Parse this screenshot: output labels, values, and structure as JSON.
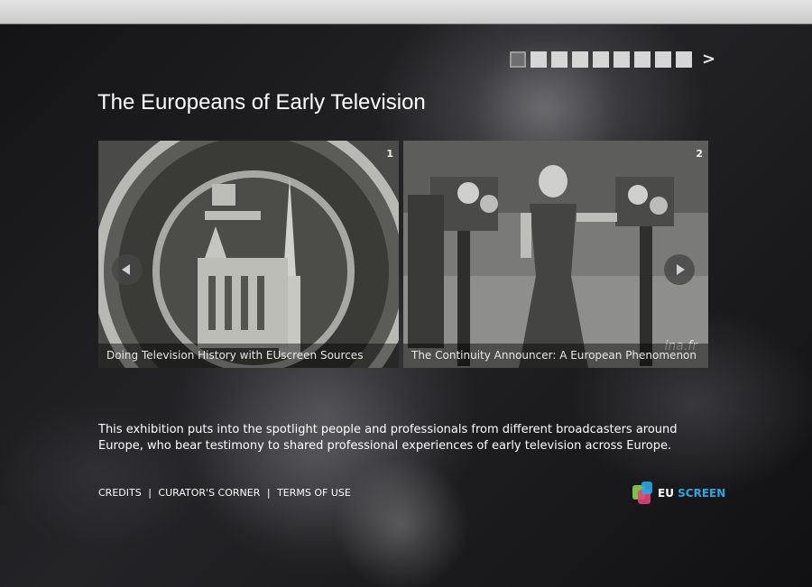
{
  "header": {
    "title": "The Europeans of Early Television"
  },
  "pager": {
    "pages": 9,
    "active": 1,
    "next_label": ">"
  },
  "tiles": [
    {
      "number": "1",
      "caption": "Doing Television History with EUscreen Sources"
    },
    {
      "number": "2",
      "caption": "The Continuity Announcer: A European Phenomenon",
      "watermark": "ina.fr"
    }
  ],
  "description": "This exhibition puts into the spotlight people and professionals from different broadcasters around Europe, who bear testimony to shared professional experiences of early television across Europe.",
  "footer": {
    "credits": "CREDITS",
    "separator": "|",
    "curators_corner": "CURATOR'S CORNER",
    "terms": "TERMS OF USE"
  },
  "logo": {
    "prefix": "EU",
    "suffix": "SCREEN"
  },
  "colors": {
    "logo_blue": "#2ea6e0",
    "logo_pink": "#e0457b",
    "logo_green": "#7bc043"
  }
}
